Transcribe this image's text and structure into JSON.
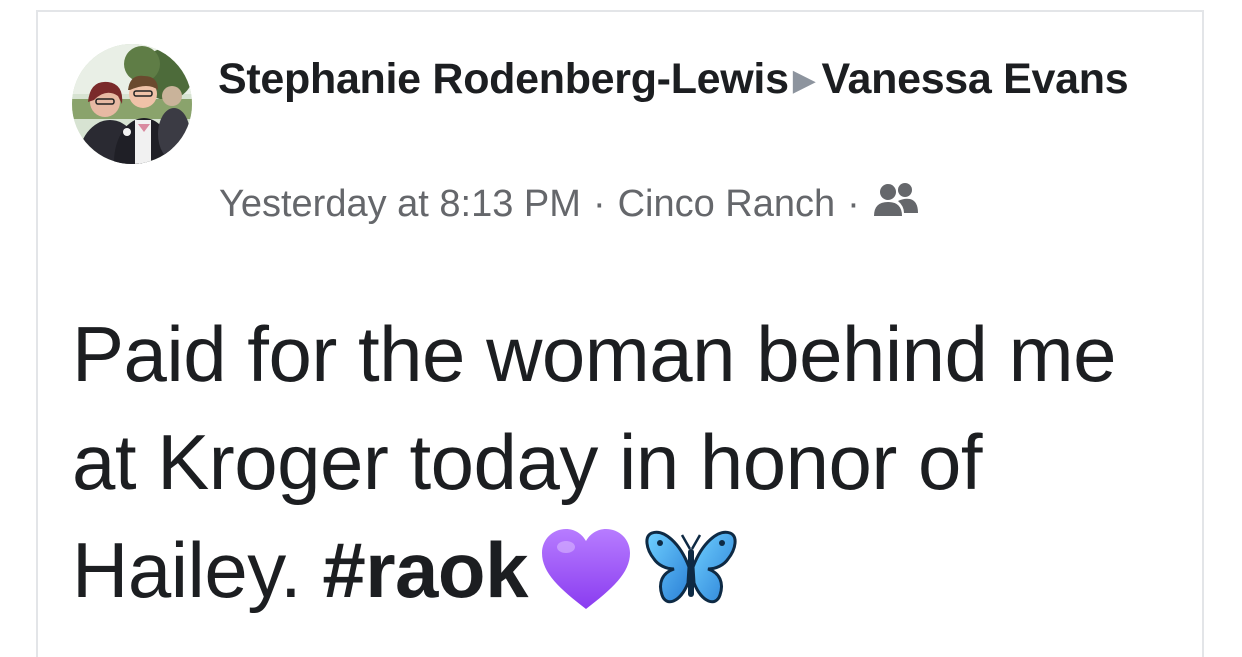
{
  "post": {
    "author": "Stephanie Rodenberg-Lewis",
    "recipient": "Vanessa Evans",
    "arrow": "▶",
    "timestamp": "Yesterday at 8:13 PM",
    "separator": "·",
    "location": "Cinco Ranch",
    "audience_icon": "friends-icon",
    "body_text": "Paid for the woman behind me at Kroger today in honor of Hailey.",
    "hashtag": "#raok",
    "emojis": [
      "purple-heart-icon",
      "butterfly-icon"
    ]
  },
  "colors": {
    "text_primary": "#1c1e21",
    "text_secondary": "#65676b",
    "arrow": "#8d949e",
    "card_border": "#e3e5e8",
    "heart": "#9b4dff",
    "butterfly": "#3aa0f0"
  }
}
